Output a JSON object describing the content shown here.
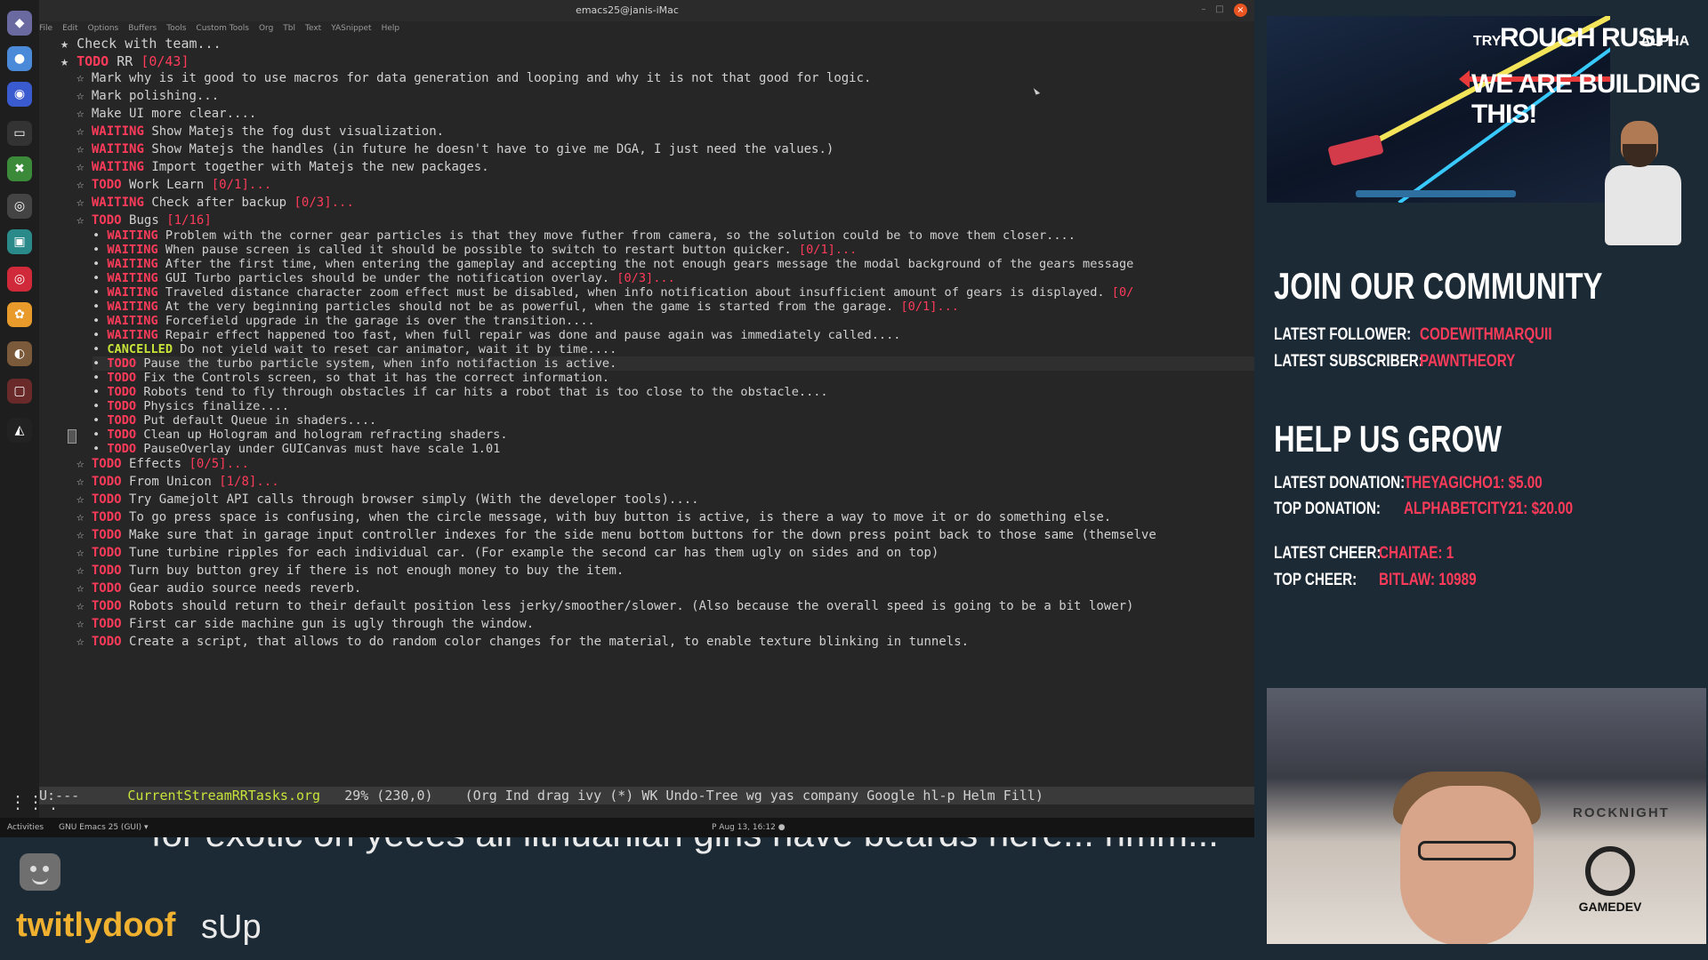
{
  "window": {
    "title": "emacs25@janis-iMac",
    "menu": [
      "File",
      "Edit",
      "Options",
      "Buffers",
      "Tools",
      "Custom Tools",
      "Org",
      "Tbl",
      "Text",
      "YASnippet",
      "Help"
    ]
  },
  "dock": {
    "icons": [
      "emacs-icon",
      "chromium-icon",
      "firefox-icon",
      "terminal-icon",
      "inkscape-icon",
      "obs-icon",
      "monitor-icon",
      "debian-icon",
      "photos-icon",
      "gimp-icon",
      "screen-icon",
      "unity-icon"
    ],
    "apps_grid_glyph": "⋮⋮⋮"
  },
  "buffer": {
    "lines": [
      {
        "star": "★",
        "kw": "",
        "text": "Check with team...",
        "cookie": ""
      },
      {
        "star": "★",
        "kw": "TODO",
        "text": "RR ",
        "cookie": "[0/43]"
      },
      {
        "star": "☆",
        "kw": "",
        "text": "Mark why is it good to use macros for data generation and looping and why it is not that good for logic.",
        "cookie": ""
      },
      {
        "star": "☆",
        "kw": "",
        "text": "Mark polishing...",
        "cookie": ""
      },
      {
        "star": "☆",
        "kw": "",
        "text": "Make UI more clear....",
        "cookie": ""
      },
      {
        "star": "☆",
        "kw": "WAITING",
        "text": "Show Matejs the fog dust visualization.",
        "cookie": ""
      },
      {
        "star": "☆",
        "kw": "WAITING",
        "text": "Show Matejs the handles (in future he doesn't have to give me DGA, I just need the values.)",
        "cookie": ""
      },
      {
        "star": "☆",
        "kw": "WAITING",
        "text": "Import together with Matejs the new packages.",
        "cookie": ""
      },
      {
        "star": "☆",
        "kw": "TODO",
        "text": "Work Learn ",
        "cookie": "[0/1]..."
      },
      {
        "star": "☆",
        "kw": "WAITING",
        "text": "Check after backup ",
        "cookie": "[0/3]..."
      },
      {
        "star": "☆",
        "kw": "TODO",
        "text": "Bugs ",
        "cookie": "[1/16]"
      },
      {
        "star": "•",
        "kw": "WAITING",
        "text": "Problem with the corner gear particles is that they move futher from camera, so the solution could be to move them closer....",
        "cookie": ""
      },
      {
        "star": "•",
        "kw": "WAITING",
        "text": "When pause screen is called it should be possible to switch to restart button quicker. ",
        "cookie": "[0/1]..."
      },
      {
        "star": "•",
        "kw": "WAITING",
        "text": "After the first time, when entering the gameplay and accepting the not enough gears message the modal background of the gears message",
        "cookie": ""
      },
      {
        "star": "•",
        "kw": "WAITING",
        "text": "GUI Turbo particles should be under the notification overlay. ",
        "cookie": "[0/3]..."
      },
      {
        "star": "•",
        "kw": "WAITING",
        "text": "Traveled distance character zoom effect must be disabled, when info notification about insufficient amount of gears is displayed. ",
        "cookie": "[0/"
      },
      {
        "star": "•",
        "kw": "WAITING",
        "text": "At the very beginning particles should not be as powerful, when the game is started from the garage. ",
        "cookie": "[0/1]..."
      },
      {
        "star": "•",
        "kw": "WAITING",
        "text": "Forcefield upgrade in the garage is over the transition....",
        "cookie": ""
      },
      {
        "star": "•",
        "kw": "WAITING",
        "text": "Repair effect happened too fast, when full repair was done and pause again was immediately called....",
        "cookie": ""
      },
      {
        "star": "•",
        "kw": "CANCELLED",
        "text": "Do not yield wait to reset car animator, wait it by time....",
        "cookie": ""
      },
      {
        "star": "•",
        "kw": "TODO",
        "text": "Pause the turbo particle system, when info notifaction is active.",
        "cookie": ""
      },
      {
        "star": "•",
        "kw": "TODO",
        "text": "Fix the Controls screen, so that it has the correct information.",
        "cookie": ""
      },
      {
        "star": "•",
        "kw": "TODO",
        "text": "Robots tend to fly through obstacles if car hits a robot that is too close to the obstacle....",
        "cookie": ""
      },
      {
        "star": "•",
        "kw": "TODO",
        "text": "Physics finalize....",
        "cookie": ""
      },
      {
        "star": "•",
        "kw": "TODO",
        "text": "Put default Queue in shaders....",
        "cookie": ""
      },
      {
        "star": "•",
        "kw": "TODO",
        "text": "Clean up Hologram and hologram refracting shaders.",
        "cookie": ""
      },
      {
        "star": "•",
        "kw": "TODO",
        "text": "PauseOverlay under GUICanvas must have scale 1.01",
        "cookie": ""
      },
      {
        "star": "☆",
        "kw": "TODO",
        "text": "Effects ",
        "cookie": "[0/5]..."
      },
      {
        "star": "☆",
        "kw": "TODO",
        "text": "From Unicon ",
        "cookie": "[1/8]..."
      },
      {
        "star": "☆",
        "kw": "TODO",
        "text": "Try Gamejolt API calls through browser simply (With the developer tools)....",
        "cookie": ""
      },
      {
        "star": "☆",
        "kw": "TODO",
        "text": "To go press space is confusing, when the circle message, with buy button is active, is there a way to move it or do something else.",
        "cookie": ""
      },
      {
        "star": "☆",
        "kw": "TODO",
        "text": "Make sure that in garage input controller indexes for the side menu bottom buttons for the down press point back to those same (themselve",
        "cookie": ""
      },
      {
        "star": "☆",
        "kw": "TODO",
        "text": "Tune turbine ripples for each individual car. (For example the second car has them ugly on sides and on top)",
        "cookie": ""
      },
      {
        "star": "☆",
        "kw": "TODO",
        "text": "Turn buy button grey if there is not enough money to buy the item.",
        "cookie": ""
      },
      {
        "star": "☆",
        "kw": "TODO",
        "text": "Gear audio source needs reverb.",
        "cookie": ""
      },
      {
        "star": "☆",
        "kw": "TODO",
        "text": "Robots should return to their default position less jerky/smoother/slower. (Also because the overall speed is going to be a bit lower)",
        "cookie": ""
      },
      {
        "star": "☆",
        "kw": "TODO",
        "text": "First car side machine gun is ugly through the window.",
        "cookie": ""
      },
      {
        "star": "☆",
        "kw": "TODO",
        "text": "Create a script, that allows to do random color changes for the material, to enable texture blinking in tunnels.",
        "cookie": ""
      }
    ]
  },
  "modeline": {
    "state": "U:---",
    "buffer_name": "CurrentStreamRRTasks.org",
    "position": "29% (230,0)",
    "modes": "(Org Ind drag ivy (*) WK Undo-Tree wg yas company Google hl-p Helm Fill)"
  },
  "taskbar": {
    "activities": "Activities",
    "app": "GNU Emacs 25 (GUI) ▾",
    "clock": "P Aug 13, 16:12 ●"
  },
  "chat": {
    "ghost_text": "for exotic      oh yeees all lithuanian girls have beards here... hmm...",
    "username": "twitlydoof",
    "message": "sUp"
  },
  "promo": {
    "try": "TRY",
    "title": "ROUGH RUSH",
    "alpha": "ALPHA",
    "building": "WE ARE BUILDING THIS!"
  },
  "community": {
    "heading": "JOIN OUR COMMUNITY",
    "latest_follower_label": "LATEST FOLLOWER:",
    "latest_follower": "CODEWITHMARQUII",
    "latest_subscriber_label": "LATEST SUBSCRIBER:",
    "latest_subscriber": "PAWNTHEORY"
  },
  "grow": {
    "heading": "HELP US GROW",
    "latest_donation_label": "LATEST DONATION:",
    "latest_donation": "THEYAGICHO1: $5.00",
    "top_donation_label": "TOP DONATION:",
    "top_donation": "ALPHABETCITY21: $20.00",
    "latest_cheer_label": "LATEST CHEER:",
    "latest_cheer": "CHAITAE: 1",
    "top_cheer_label": "TOP CHEER:",
    "top_cheer": "BITLAW: 10989"
  },
  "webcam": {
    "shirt_text": "ROCKNIGHT",
    "badge": "GAMEDEV"
  }
}
